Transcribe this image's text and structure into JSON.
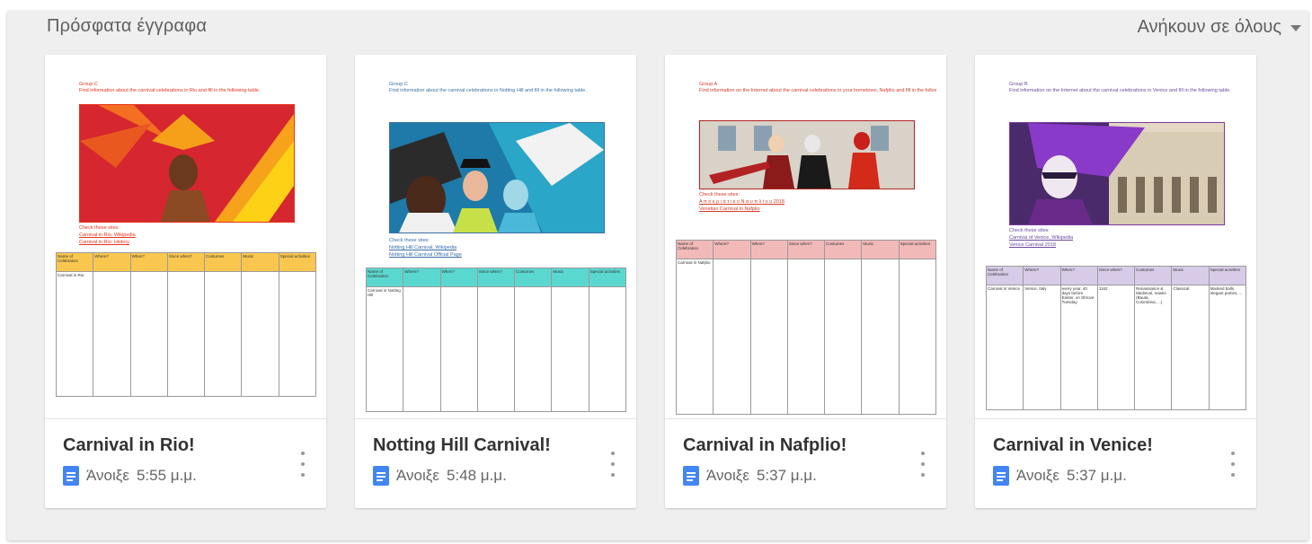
{
  "header": {
    "title": "Πρόσφατα έγγραφα",
    "owner_filter": "Ανήκουν σε όλους"
  },
  "documents": [
    {
      "title": "Carnival in Rio!",
      "opened_label": "Άνοιξε",
      "time": "5:55 μ.μ.",
      "preview": {
        "text_color": "#e8331c",
        "header_color": "#f9c74f",
        "line1": "Group C",
        "line2": "Find information about the carnival celebrations in Rio and fill in the following table.",
        "links_heading": "Check these sites:",
        "link1": "Carnival in Rio, Wikipedia",
        "link2": "Carnival in Rio: History",
        "row_name": "Carnival in Rio"
      }
    },
    {
      "title": "Notting Hill Carnival!",
      "opened_label": "Άνοιξε",
      "time": "5:48 μ.μ.",
      "preview": {
        "text_color": "#3a6fa8",
        "header_color": "#5ad8cf",
        "line1": "Group C",
        "line2": "Find information about the carnival celebrations in Notting Hill and fill in the following table.",
        "links_heading": "Check these sites:",
        "link1": "Notting Hill Carnival, Wikipedia",
        "link2": "Notting Hill Carnival Official Page",
        "row_name": "Carnival in Notting Hill"
      }
    },
    {
      "title": "Carnival in Nafplio!",
      "opened_label": "Άνοιξε",
      "time": "5:37 μ.μ.",
      "preview": {
        "text_color": "#d43a2a",
        "header_color": "#f2b9b9",
        "line1": "Group A",
        "line2": "Find information on the Internet about the carnival celebrations in your hometown, Nafplio and fill in the following table.",
        "links_heading": "Check these sites:",
        "link1": "Α π ο κ ρ ι ά τ ι κ ο  Ν α υ π λ ί ο υ  2018",
        "link2": "Venetian Carnival in Nafplio",
        "row_name": "Carnival in Nafplio"
      }
    },
    {
      "title": "Carnival in Venice!",
      "opened_label": "Άνοιξε",
      "time": "5:37 μ.μ.",
      "preview": {
        "text_color": "#6a4aa0",
        "header_color": "#d8cbe8",
        "line1": "Group B",
        "line2": "Find information on the Internet about the carnival celebrations in Venice and fill in the following table.",
        "links_heading": "Check these sites:",
        "link1": "Carnival of Venice, Wikipedia",
        "link2": "Venice Carnival 2018",
        "row_name": "Carnival in Venice",
        "row_where": "Venice, Italy",
        "row_when": "every year, 40 days before Easter, on Shrove Tuesday",
        "row_since": "1162",
        "row_costumes": "Renaissance & Medieval, masks (Bauta, Colombina, ...)",
        "row_music": "Classical",
        "row_special": "Masked balls, elegant parties, ..."
      }
    }
  ],
  "table_headers": [
    "Name of Celebration",
    "Where?",
    "When?",
    "Since when?",
    "Costumes",
    "Music",
    "Special activities"
  ]
}
